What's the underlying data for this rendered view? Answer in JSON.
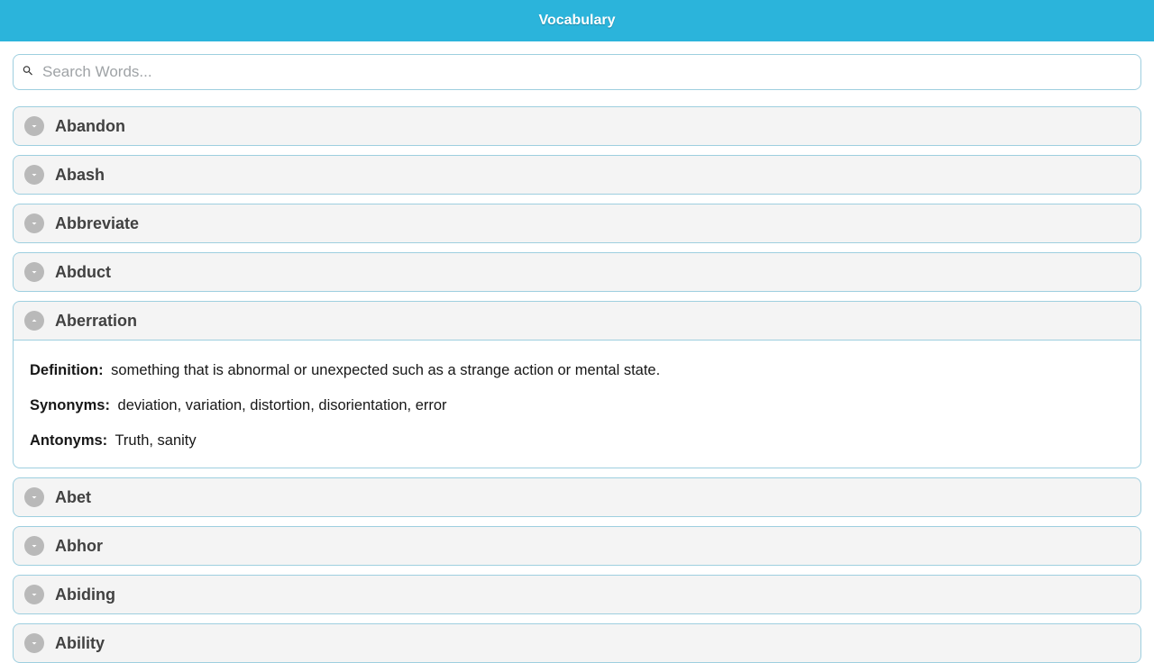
{
  "header": {
    "title": "Vocabulary"
  },
  "search": {
    "placeholder": "Search Words..."
  },
  "labels": {
    "definition": "Definition:",
    "synonyms": "Synonyms:",
    "antonyms": "Antonyms:"
  },
  "words": [
    {
      "word": "Abandon",
      "expanded": false
    },
    {
      "word": "Abash",
      "expanded": false
    },
    {
      "word": "Abbreviate",
      "expanded": false
    },
    {
      "word": "Abduct",
      "expanded": false
    },
    {
      "word": "Aberration",
      "expanded": true,
      "definition": "something that is abnormal or unexpected such as a strange action or mental state.",
      "synonyms": "deviation, variation, distortion, disorientation, error",
      "antonyms": "Truth, sanity"
    },
    {
      "word": "Abet",
      "expanded": false
    },
    {
      "word": "Abhor",
      "expanded": false
    },
    {
      "word": "Abiding",
      "expanded": false
    },
    {
      "word": "Ability",
      "expanded": false
    }
  ]
}
